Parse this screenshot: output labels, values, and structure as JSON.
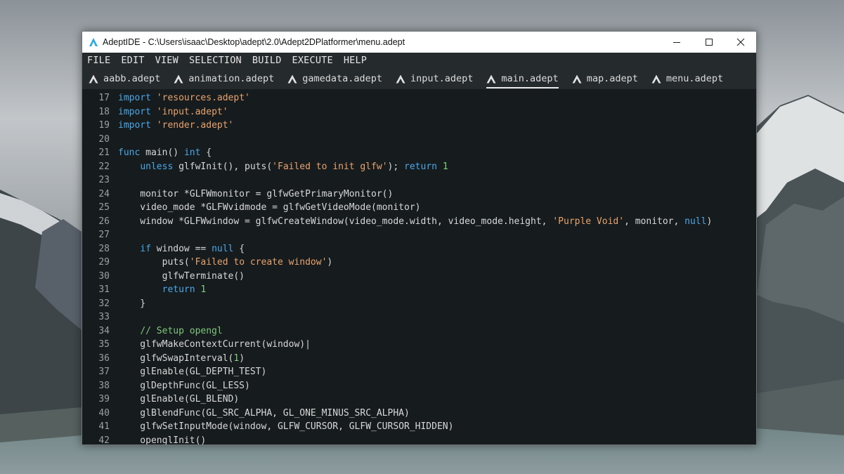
{
  "window": {
    "title": "AdeptIDE - C:\\Users\\isaac\\Desktop\\adept\\2.0\\Adept2DPlatformer\\menu.adept",
    "controls": {
      "minimize": "minimize-icon",
      "maximize": "maximize-icon",
      "close": "close-icon"
    }
  },
  "menu": {
    "items": [
      "FILE",
      "EDIT",
      "VIEW",
      "SELECTION",
      "BUILD",
      "EXECUTE",
      "HELP"
    ]
  },
  "tabs": {
    "items": [
      {
        "label": "aabb.adept",
        "active": false
      },
      {
        "label": "animation.adept",
        "active": false
      },
      {
        "label": "gamedata.adept",
        "active": false
      },
      {
        "label": "input.adept",
        "active": false
      },
      {
        "label": "main.adept",
        "active": true
      },
      {
        "label": "map.adept",
        "active": false
      },
      {
        "label": "menu.adept",
        "active": false
      }
    ]
  },
  "editor": {
    "lines": [
      {
        "n": "17",
        "tokens": [
          [
            "kw",
            "import"
          ],
          [
            "p",
            " "
          ],
          [
            "str",
            "'resources.adept'"
          ]
        ]
      },
      {
        "n": "18",
        "tokens": [
          [
            "kw",
            "import"
          ],
          [
            "p",
            " "
          ],
          [
            "str",
            "'input.adept'"
          ]
        ]
      },
      {
        "n": "19",
        "tokens": [
          [
            "kw",
            "import"
          ],
          [
            "p",
            " "
          ],
          [
            "str",
            "'render.adept'"
          ]
        ]
      },
      {
        "n": "20",
        "tokens": []
      },
      {
        "n": "21",
        "tokens": [
          [
            "kw",
            "func"
          ],
          [
            "p",
            " main() "
          ],
          [
            "kw",
            "int"
          ],
          [
            "p",
            " {"
          ]
        ]
      },
      {
        "n": "22",
        "tokens": [
          [
            "p",
            "    "
          ],
          [
            "kw",
            "unless"
          ],
          [
            "p",
            " glfwInit(), puts("
          ],
          [
            "str",
            "'Failed to init glfw'"
          ],
          [
            "p",
            "); "
          ],
          [
            "kw",
            "return"
          ],
          [
            "p",
            " "
          ],
          [
            "num",
            "1"
          ]
        ]
      },
      {
        "n": "23",
        "tokens": []
      },
      {
        "n": "24",
        "tokens": [
          [
            "p",
            "    monitor *GLFWmonitor = glfwGetPrimaryMonitor()"
          ]
        ]
      },
      {
        "n": "25",
        "tokens": [
          [
            "p",
            "    video_mode *GLFWvidmode = glfwGetVideoMode(monitor)"
          ]
        ]
      },
      {
        "n": "26",
        "tokens": [
          [
            "p",
            "    window *GLFWwindow = glfwCreateWindow(video_mode.width, video_mode.height, "
          ],
          [
            "str",
            "'Purple Void'"
          ],
          [
            "p",
            ", monitor, "
          ],
          [
            "kw",
            "null"
          ],
          [
            "p",
            ")"
          ]
        ]
      },
      {
        "n": "27",
        "tokens": []
      },
      {
        "n": "28",
        "tokens": [
          [
            "p",
            "    "
          ],
          [
            "kw",
            "if"
          ],
          [
            "p",
            " window == "
          ],
          [
            "kw",
            "null"
          ],
          [
            "p",
            " {"
          ]
        ]
      },
      {
        "n": "29",
        "tokens": [
          [
            "p",
            "        puts("
          ],
          [
            "str",
            "'Failed to create window'"
          ],
          [
            "p",
            ")"
          ]
        ]
      },
      {
        "n": "30",
        "tokens": [
          [
            "p",
            "        glfwTerminate()"
          ]
        ]
      },
      {
        "n": "31",
        "tokens": [
          [
            "p",
            "        "
          ],
          [
            "kw",
            "return"
          ],
          [
            "p",
            " "
          ],
          [
            "num",
            "1"
          ]
        ]
      },
      {
        "n": "32",
        "tokens": [
          [
            "p",
            "    }"
          ]
        ]
      },
      {
        "n": "33",
        "tokens": []
      },
      {
        "n": "34",
        "tokens": [
          [
            "p",
            "    "
          ],
          [
            "cmt",
            "// Setup opengl"
          ]
        ]
      },
      {
        "n": "35",
        "tokens": [
          [
            "p",
            "    glfwMakeContextCurrent(window)|"
          ]
        ]
      },
      {
        "n": "36",
        "tokens": [
          [
            "p",
            "    glfwSwapInterval("
          ],
          [
            "num",
            "1"
          ],
          [
            "p",
            ")"
          ]
        ]
      },
      {
        "n": "37",
        "tokens": [
          [
            "p",
            "    glEnable(GL_DEPTH_TEST)"
          ]
        ]
      },
      {
        "n": "38",
        "tokens": [
          [
            "p",
            "    glDepthFunc(GL_LESS)"
          ]
        ]
      },
      {
        "n": "39",
        "tokens": [
          [
            "p",
            "    glEnable(GL_BLEND)"
          ]
        ]
      },
      {
        "n": "40",
        "tokens": [
          [
            "p",
            "    glBlendFunc(GL_SRC_ALPHA, GL_ONE_MINUS_SRC_ALPHA)"
          ]
        ]
      },
      {
        "n": "41",
        "tokens": [
          [
            "p",
            "    glfwSetInputMode(window, GLFW_CURSOR, GLFW_CURSOR_HIDDEN)"
          ]
        ]
      },
      {
        "n": "42",
        "tokens": [
          [
            "p",
            "    openglInit()"
          ]
        ]
      }
    ]
  },
  "colors": {
    "editor_bg": "#161b1e",
    "chrome_bg": "#252a2d",
    "keyword": "#4aa8e8",
    "string": "#e8a36e",
    "number": "#7fd07a",
    "comment": "#7fc77a",
    "text": "#d8d8d8",
    "line_number": "#9aa0a3"
  }
}
